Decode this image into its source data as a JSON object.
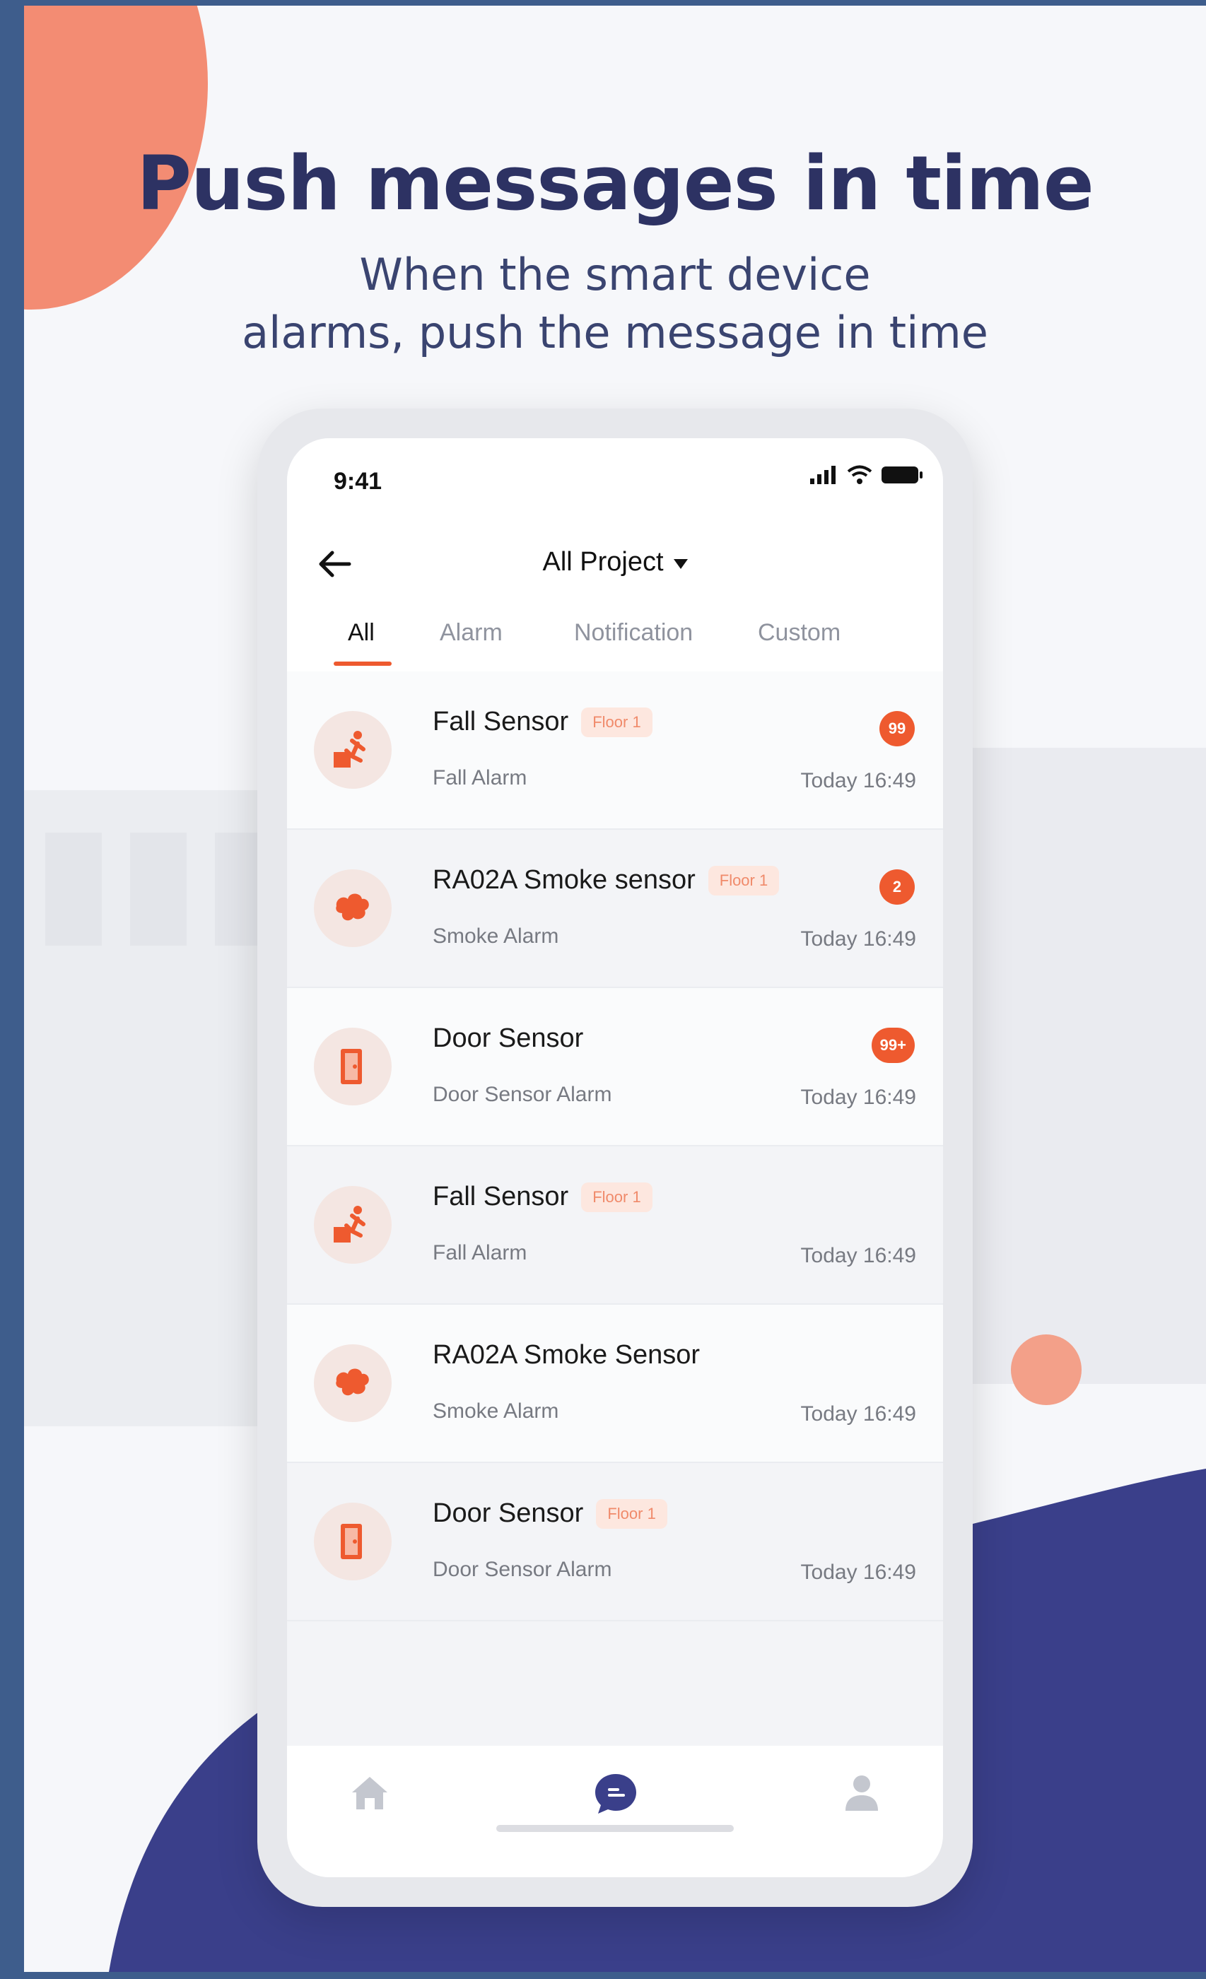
{
  "hero": {
    "headline": "Push messages in time",
    "sub_line1": "When the smart device",
    "sub_line2": "alarms, push the message in time"
  },
  "colors": {
    "navy": "#3a3f8a",
    "coral": "#f38c73",
    "accent": "#ee5a2f",
    "frame": "#3e5d8c"
  },
  "status_bar": {
    "time": "9:41",
    "icons": [
      "signal-icon",
      "wifi-icon",
      "battery-icon"
    ]
  },
  "nav": {
    "back_icon": "arrow-left-icon",
    "title": "All Project",
    "dropdown_icon": "caret-down-icon"
  },
  "tabs": [
    {
      "label": "All",
      "active": true
    },
    {
      "label": "Alarm",
      "active": false
    },
    {
      "label": "Notification",
      "active": false
    },
    {
      "label": "Custom",
      "active": false
    }
  ],
  "messages": [
    {
      "icon": "fall-sensor-icon",
      "title": "Fall Sensor",
      "tag": "Floor 1",
      "subtitle": "Fall Alarm",
      "time": "Today 16:49",
      "badge": "99"
    },
    {
      "icon": "smoke-sensor-icon",
      "title": "RA02A Smoke sensor",
      "tag": "Floor 1",
      "subtitle": "Smoke Alarm",
      "time": "Today 16:49",
      "badge": "2"
    },
    {
      "icon": "door-sensor-icon",
      "title": "Door Sensor",
      "tag": "",
      "subtitle": "Door Sensor Alarm",
      "time": "Today 16:49",
      "badge": "99+"
    },
    {
      "icon": "fall-sensor-icon",
      "title": "Fall Sensor",
      "tag": "Floor 1",
      "subtitle": "Fall Alarm",
      "time": "Today 16:49",
      "badge": ""
    },
    {
      "icon": "smoke-sensor-icon",
      "title": "RA02A Smoke Sensor",
      "tag": "",
      "subtitle": "Smoke Alarm",
      "time": "Today 16:49",
      "badge": ""
    },
    {
      "icon": "door-sensor-icon",
      "title": "Door Sensor",
      "tag": "Floor 1",
      "subtitle": "Door Sensor Alarm",
      "time": "Today 16:49",
      "badge": ""
    }
  ],
  "bottom_nav": [
    {
      "icon": "home-icon",
      "active": false
    },
    {
      "icon": "message-icon",
      "active": true
    },
    {
      "icon": "profile-icon",
      "active": false
    }
  ]
}
